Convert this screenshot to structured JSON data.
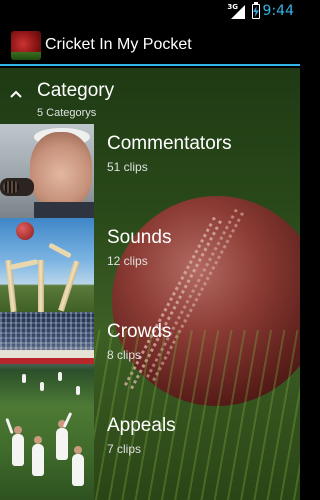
{
  "status_bar": {
    "network": "3G",
    "time": "9:44",
    "icons": [
      "signal-icon",
      "battery-charging-icon"
    ]
  },
  "action_bar": {
    "title": "Cricket In My Pocket",
    "icon": "cricket-ball-app-icon"
  },
  "category_header": {
    "label": "Category",
    "subtitle": "5 Categorys",
    "icon": "collapse-chevron-up-icon"
  },
  "categories": [
    {
      "name": "Commentators",
      "count": "51 clips",
      "thumb": "commentator-thumbnail"
    },
    {
      "name": "Sounds",
      "count": "12 clips",
      "thumb": "stumps-thumbnail"
    },
    {
      "name": "Crowds",
      "count": "8 clips",
      "thumb": "crowd-thumbnail"
    },
    {
      "name": "Appeals",
      "count": "7 clips",
      "thumb": "appeals-thumbnail"
    }
  ],
  "colors": {
    "accent": "#33b5e5",
    "background": "#000000"
  }
}
